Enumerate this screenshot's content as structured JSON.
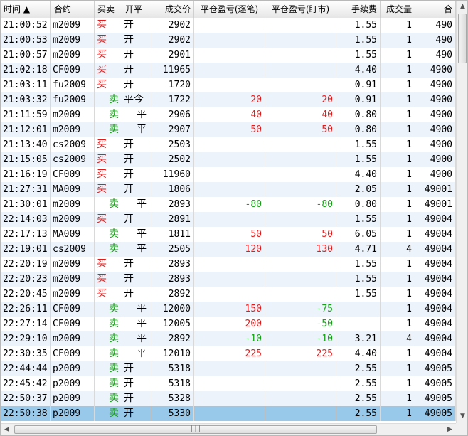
{
  "columns": [
    {
      "label": "时间 ▲",
      "align": "left"
    },
    {
      "label": "合约",
      "align": "left"
    },
    {
      "label": "买卖",
      "align": "left"
    },
    {
      "label": "开平",
      "align": "left"
    },
    {
      "label": "成交价",
      "align": "right"
    },
    {
      "label": "平仓盈亏(逐笔)",
      "align": "center"
    },
    {
      "label": "平仓盈亏(盯市)",
      "align": "center"
    },
    {
      "label": "手续费",
      "align": "right"
    },
    {
      "label": "成交量",
      "align": "right"
    },
    {
      "label": "合",
      "align": "right"
    }
  ],
  "rows": [
    {
      "time": "21:00:52",
      "code": "m2009",
      "side": "买",
      "oc": "开",
      "price": "2902",
      "pnl1": "",
      "pnl2": "",
      "fee": "1.55",
      "qty": "1",
      "ref": "490"
    },
    {
      "time": "21:00:53",
      "code": "m2009",
      "side": "买",
      "oc": "开",
      "price": "2902",
      "pnl1": "",
      "pnl2": "",
      "fee": "1.55",
      "qty": "1",
      "ref": "490"
    },
    {
      "time": "21:00:57",
      "code": "m2009",
      "side": "买",
      "oc": "开",
      "price": "2901",
      "pnl1": "",
      "pnl2": "",
      "fee": "1.55",
      "qty": "1",
      "ref": "490"
    },
    {
      "time": "21:02:18",
      "code": "CF009",
      "side": "买",
      "oc": "开",
      "price": "11965",
      "pnl1": "",
      "pnl2": "",
      "fee": "4.40",
      "qty": "1",
      "ref": "4900"
    },
    {
      "time": "21:03:11",
      "code": "fu2009",
      "side": "买",
      "oc": "开",
      "price": "1720",
      "pnl1": "",
      "pnl2": "",
      "fee": "0.91",
      "qty": "1",
      "ref": "4900"
    },
    {
      "time": "21:03:32",
      "code": "fu2009",
      "side": "卖",
      "oc": "平今",
      "price": "1722",
      "pnl1": "20",
      "pnl2": "20",
      "fee": "0.91",
      "qty": "1",
      "ref": "4900"
    },
    {
      "time": "21:11:59",
      "code": "m2009",
      "side": "卖",
      "oc": "平",
      "price": "2906",
      "pnl1": "40",
      "pnl2": "40",
      "fee": "0.80",
      "qty": "1",
      "ref": "4900"
    },
    {
      "time": "21:12:01",
      "code": "m2009",
      "side": "卖",
      "oc": "平",
      "price": "2907",
      "pnl1": "50",
      "pnl2": "50",
      "fee": "0.80",
      "qty": "1",
      "ref": "4900"
    },
    {
      "time": "21:13:40",
      "code": "cs2009",
      "side": "买",
      "oc": "开",
      "price": "2503",
      "pnl1": "",
      "pnl2": "",
      "fee": "1.55",
      "qty": "1",
      "ref": "4900"
    },
    {
      "time": "21:15:05",
      "code": "cs2009",
      "side": "买",
      "oc": "开",
      "price": "2502",
      "pnl1": "",
      "pnl2": "",
      "fee": "1.55",
      "qty": "1",
      "ref": "4900"
    },
    {
      "time": "21:16:19",
      "code": "CF009",
      "side": "买",
      "oc": "开",
      "price": "11960",
      "pnl1": "",
      "pnl2": "",
      "fee": "4.40",
      "qty": "1",
      "ref": "4900"
    },
    {
      "time": "21:27:31",
      "code": "MA009",
      "side": "买",
      "oc": "开",
      "price": "1806",
      "pnl1": "",
      "pnl2": "",
      "fee": "2.05",
      "qty": "1",
      "ref": "49001"
    },
    {
      "time": "21:30:01",
      "code": "m2009",
      "side": "卖",
      "oc": "平",
      "price": "2893",
      "pnl1": "-80",
      "pnl2": "-80",
      "fee": "0.80",
      "qty": "1",
      "ref": "49001"
    },
    {
      "time": "22:14:03",
      "code": "m2009",
      "side": "买",
      "oc": "开",
      "price": "2891",
      "pnl1": "",
      "pnl2": "",
      "fee": "1.55",
      "qty": "1",
      "ref": "49004"
    },
    {
      "time": "22:17:13",
      "code": "MA009",
      "side": "卖",
      "oc": "平",
      "price": "1811",
      "pnl1": "50",
      "pnl2": "50",
      "fee": "6.05",
      "qty": "1",
      "ref": "49004"
    },
    {
      "time": "22:19:01",
      "code": "cs2009",
      "side": "卖",
      "oc": "平",
      "price": "2505",
      "pnl1": "120",
      "pnl2": "130",
      "fee": "4.71",
      "qty": "4",
      "ref": "49004"
    },
    {
      "time": "22:20:19",
      "code": "m2009",
      "side": "买",
      "oc": "开",
      "price": "2893",
      "pnl1": "",
      "pnl2": "",
      "fee": "1.55",
      "qty": "1",
      "ref": "49004"
    },
    {
      "time": "22:20:23",
      "code": "m2009",
      "side": "买",
      "oc": "开",
      "price": "2893",
      "pnl1": "",
      "pnl2": "",
      "fee": "1.55",
      "qty": "1",
      "ref": "49004"
    },
    {
      "time": "22:20:45",
      "code": "m2009",
      "side": "买",
      "oc": "开",
      "price": "2892",
      "pnl1": "",
      "pnl2": "",
      "fee": "1.55",
      "qty": "1",
      "ref": "49004"
    },
    {
      "time": "22:26:11",
      "code": "CF009",
      "side": "卖",
      "oc": "平",
      "price": "12000",
      "pnl1": "150",
      "pnl2": "-75",
      "fee": "",
      "qty": "1",
      "ref": "49004"
    },
    {
      "time": "22:27:14",
      "code": "CF009",
      "side": "卖",
      "oc": "平",
      "price": "12005",
      "pnl1": "200",
      "pnl2": "-50",
      "fee": "",
      "qty": "1",
      "ref": "49004"
    },
    {
      "time": "22:29:10",
      "code": "m2009",
      "side": "卖",
      "oc": "平",
      "price": "2892",
      "pnl1": "-10",
      "pnl2": "-10",
      "fee": "3.21",
      "qty": "4",
      "ref": "49004"
    },
    {
      "time": "22:30:35",
      "code": "CF009",
      "side": "卖",
      "oc": "平",
      "price": "12010",
      "pnl1": "225",
      "pnl2": "225",
      "fee": "4.40",
      "qty": "1",
      "ref": "49004"
    },
    {
      "time": "22:44:44",
      "code": "p2009",
      "side": "卖",
      "oc": "开",
      "price": "5318",
      "pnl1": "",
      "pnl2": "",
      "fee": "2.55",
      "qty": "1",
      "ref": "49005"
    },
    {
      "time": "22:45:42",
      "code": "p2009",
      "side": "卖",
      "oc": "开",
      "price": "5318",
      "pnl1": "",
      "pnl2": "",
      "fee": "2.55",
      "qty": "1",
      "ref": "49005"
    },
    {
      "time": "22:50:37",
      "code": "p2009",
      "side": "卖",
      "oc": "开",
      "price": "5328",
      "pnl1": "",
      "pnl2": "",
      "fee": "2.55",
      "qty": "1",
      "ref": "49005"
    },
    {
      "time": "22:50:38",
      "code": "p2009",
      "side": "卖",
      "oc": "开",
      "price": "5330",
      "pnl1": "",
      "pnl2": "",
      "fee": "2.55",
      "qty": "1",
      "ref": "49005"
    }
  ],
  "selected_row": 26,
  "colors": {
    "buy": "#e41a1a",
    "sell": "#15a015",
    "selected": "#99c9ea",
    "alt_row": "#ecf3fb"
  },
  "scrollbar": {
    "grip": "|||"
  }
}
